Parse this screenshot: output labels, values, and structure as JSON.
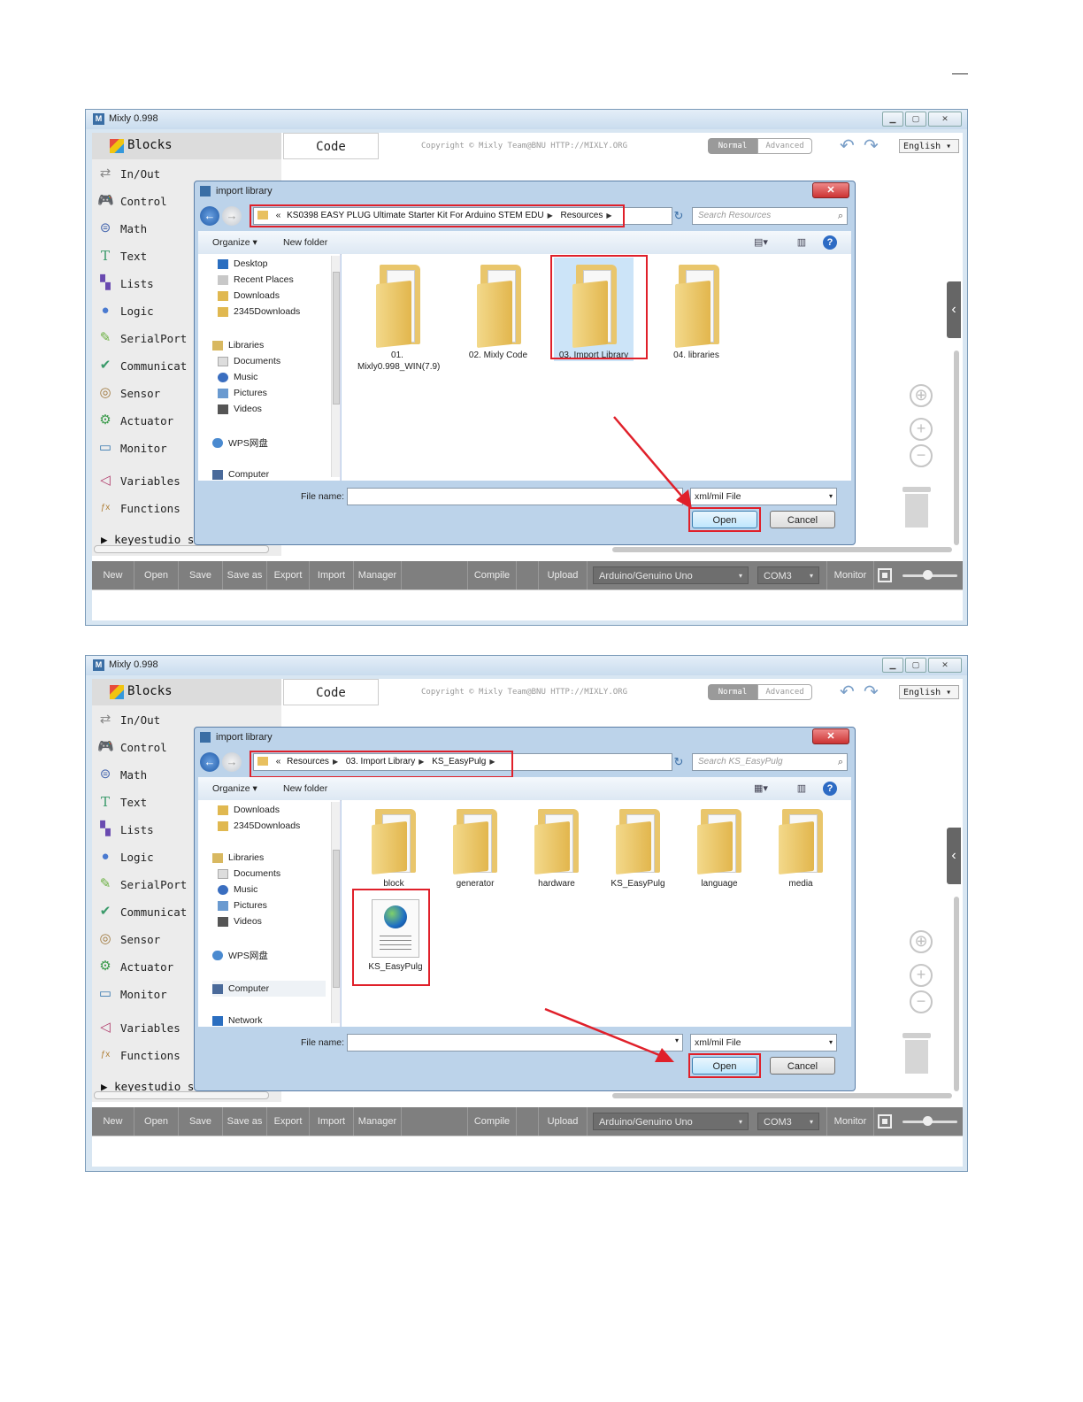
{
  "common": {
    "app_title": "Mixly 0.998",
    "blocks_tab": "Blocks",
    "code_tab": "Code",
    "copyright": "Copyright © Mixly Team@BNU HTTP://MIXLY.ORG",
    "mode_normal": "Normal",
    "mode_advanced": "Advanced",
    "language": "English",
    "categories": [
      {
        "label": "In/Out",
        "icon": "in-out-icon",
        "color": "#888888"
      },
      {
        "label": "Control",
        "icon": "gamepad-icon",
        "color": "#4a9e3a"
      },
      {
        "label": "Math",
        "icon": "math-icon",
        "color": "#4a6ab0"
      },
      {
        "label": "Text",
        "icon": "text-icon",
        "color": "#3a9a6a"
      },
      {
        "label": "Lists",
        "icon": "lists-icon",
        "color": "#6a4ab0"
      },
      {
        "label": "Logic",
        "icon": "bulb-icon",
        "color": "#4a7ad0"
      },
      {
        "label": "SerialPort",
        "icon": "pen-icon",
        "color": "#6ab040"
      },
      {
        "label": "Communicat",
        "icon": "comm-icon",
        "color": "#3a9a6a"
      },
      {
        "label": "Sensor",
        "icon": "sensor-icon",
        "color": "#a07a40"
      },
      {
        "label": "Actuator",
        "icon": "actuator-icon",
        "color": "#3a9a4a"
      },
      {
        "label": "Monitor",
        "icon": "monitor-icon",
        "color": "#3a7ab0"
      },
      {
        "label": "Variables",
        "icon": "variables-icon",
        "color": "#b03a6a"
      },
      {
        "label": "Functions",
        "icon": "functions-icon",
        "color": "#b0803a"
      }
    ],
    "kit": "keyestudio starter kit",
    "toolbar": {
      "new": "New",
      "open": "Open",
      "save": "Save",
      "save_as": "Save as",
      "export": "Export",
      "import": "Import",
      "manager": "Manager",
      "compile": "Compile",
      "upload": "Upload",
      "board": "Arduino/Genuino Uno",
      "port": "COM3",
      "monitor": "Monitor"
    },
    "dialog": {
      "title": "import library",
      "organize": "Organize",
      "new_folder": "New folder",
      "file_name_label": "File name:",
      "file_type": "xml/mil File",
      "open_button": "Open",
      "cancel_button": "Cancel"
    }
  },
  "shot1": {
    "address": {
      "prefix": "«",
      "segments": [
        "KS0398 EASY PLUG Ultimate Starter Kit For Arduino STEM EDU",
        "Resources"
      ]
    },
    "search_placeholder": "Search Resources",
    "nav": [
      "Desktop",
      "Recent Places",
      "Downloads",
      "2345Downloads",
      "Libraries",
      "Documents",
      "Music",
      "Pictures",
      "Videos",
      "WPS网盘",
      "Computer"
    ],
    "files": [
      "01. Mixly0.998_WIN(7.9)",
      "02. Mixly Code",
      "03. Import Library",
      "04. libraries"
    ]
  },
  "shot2": {
    "address": {
      "prefix": "«",
      "segments": [
        "Resources",
        "03. Import Library",
        "KS_EasyPulg"
      ]
    },
    "search_placeholder": "Search KS_EasyPulg",
    "nav": [
      "Downloads",
      "2345Downloads",
      "Libraries",
      "Documents",
      "Music",
      "Pictures",
      "Videos",
      "WPS网盘",
      "Computer",
      "Network"
    ],
    "files": [
      "block",
      "generator",
      "hardware",
      "KS_EasyPulg",
      "language",
      "media"
    ],
    "file_doc": "KS_EasyPulg"
  }
}
